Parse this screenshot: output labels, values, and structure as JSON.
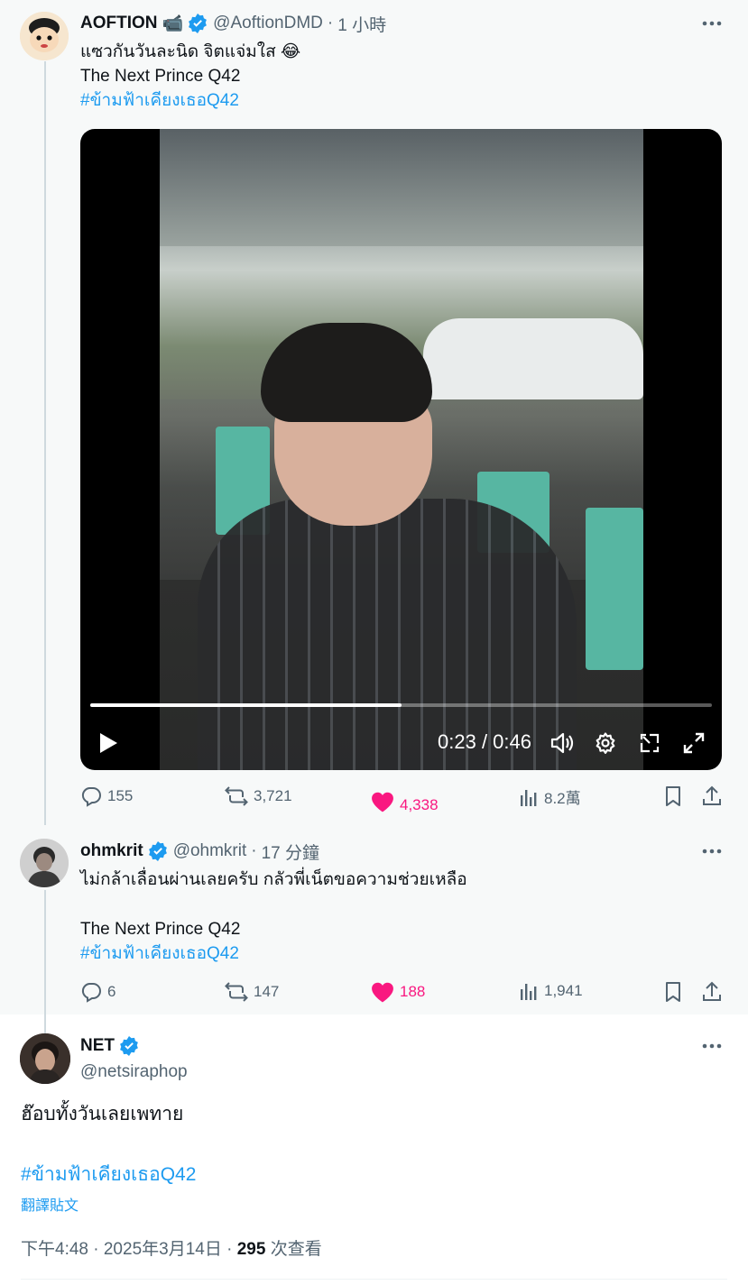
{
  "tweets": [
    {
      "name": "AOFTION",
      "name_emoji": "📹",
      "handle": "@AoftionDMD",
      "time": "1 小時",
      "lines": [
        "แซวกันวันละนิด จิตแจ่มใส 😂",
        "The Next Prince Q42"
      ],
      "hashtag": "#ข้ามฟ้าเคียงเธอQ42",
      "video": {
        "current_time": "0:23",
        "duration": "0:46",
        "progress": 0.5
      },
      "actions": {
        "replies": "155",
        "retweets": "3,721",
        "likes": "4,338",
        "views": "8.2萬"
      },
      "liked": true
    },
    {
      "name": "ohmkrit",
      "handle": "@ohmkrit",
      "time": "17 分鐘",
      "lines": [
        "ไม่กล้าเลื่อนผ่านเลยครับ กลัวพี่เน็ตขอความช่วยเหลือ",
        "The Next Prince Q42"
      ],
      "hashtag": "#ข้ามฟ้าเคียงเธอQ42",
      "actions": {
        "replies": "6",
        "retweets": "147",
        "likes": "188",
        "views": "1,941"
      },
      "liked": true
    },
    {
      "name": "NET",
      "handle": "@netsiraphop",
      "text": "ฮ๊อบทั้งวันเลยเพทาย",
      "hashtag": "#ข้ามฟ้าเคียงเธอQ42",
      "translate": "翻譯貼文",
      "time_date": "下午4:48 · 2025年3月14日 · ",
      "views_count": "295",
      "views_label": " 次查看"
    }
  ],
  "colors": {
    "accent": "#1d9bf0",
    "like": "#f91880",
    "muted": "#536471",
    "text": "#0f1419"
  }
}
